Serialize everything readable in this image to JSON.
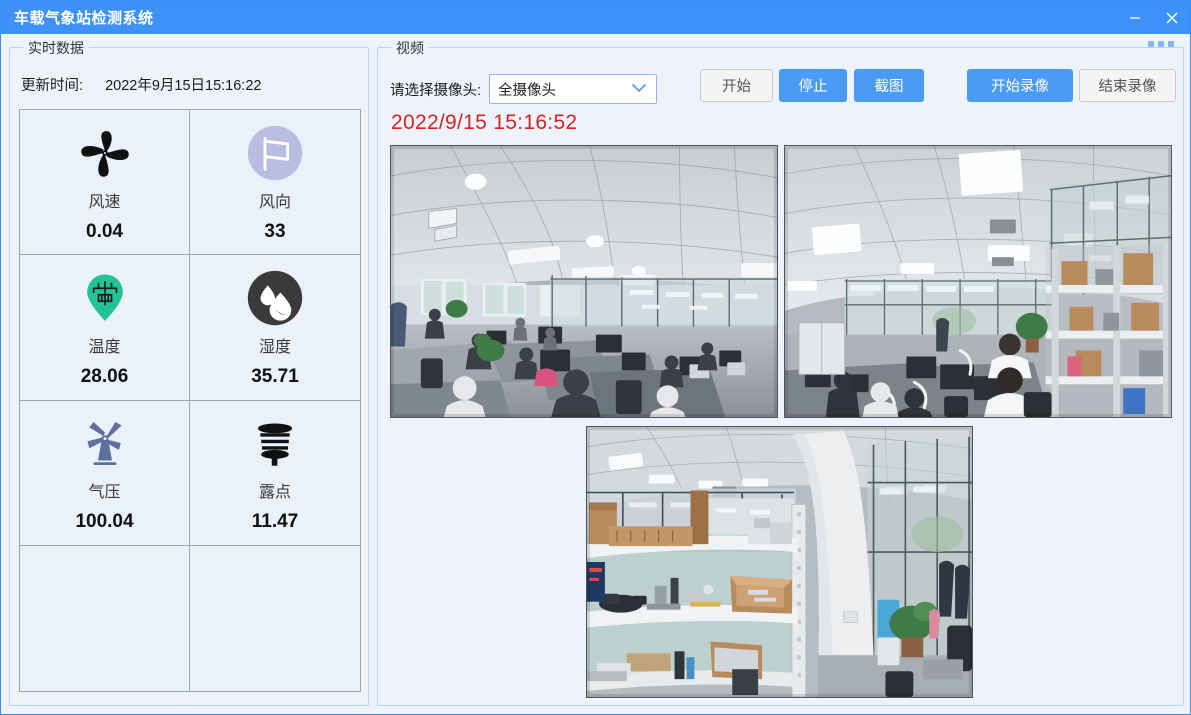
{
  "window": {
    "title": "车载气象站检测系统",
    "minimize_icon": "minimize-icon",
    "close_icon": "close-icon",
    "accent_color": "#3e92f7",
    "background_color": "#eef3fb"
  },
  "left_panel": {
    "title": "实时数据",
    "update_label": "更新时间:",
    "update_value": "2022年9月15日15:16:22",
    "metrics": [
      {
        "icon": "fan-icon",
        "label": "风速",
        "value": "0.04",
        "icon_color": "#111111"
      },
      {
        "icon": "flag-icon",
        "label": "风向",
        "value": "33",
        "icon_color": "#b9bde0"
      },
      {
        "icon": "map-pin-icon",
        "label": "温度",
        "value": "28.06",
        "icon_color": "#22c397"
      },
      {
        "icon": "water-drop-icon",
        "label": "湿度",
        "value": "35.71",
        "icon_color": "#3a3a3a"
      },
      {
        "icon": "windmill-icon",
        "label": "气压",
        "value": "100.04",
        "icon_color": "#5d719e"
      },
      {
        "icon": "dew-sensor-icon",
        "label": "露点",
        "value": "11.47",
        "icon_color": "#111111"
      },
      {
        "icon": "",
        "label": "",
        "value": "",
        "icon_color": ""
      },
      {
        "icon": "",
        "label": "",
        "value": "",
        "icon_color": ""
      }
    ]
  },
  "right_panel": {
    "title": "视频",
    "camera_label": "请选择摄像头:",
    "camera_selected": "全摄像头",
    "camera_options": [
      "全摄像头"
    ],
    "chevron_icon": "chevron-down-icon",
    "buttons": {
      "start": "开始",
      "stop": "停止",
      "screenshot": "截图",
      "record_start": "开始录像",
      "record_stop": "结束录像"
    },
    "record_timestamp": "2022/9/15 15:16:52",
    "record_timestamp_color": "#d42323",
    "videos": [
      {
        "name": "camera-feed-1",
        "caption": ""
      },
      {
        "name": "camera-feed-2",
        "caption": ""
      },
      {
        "name": "camera-feed-3",
        "caption": ""
      }
    ]
  }
}
